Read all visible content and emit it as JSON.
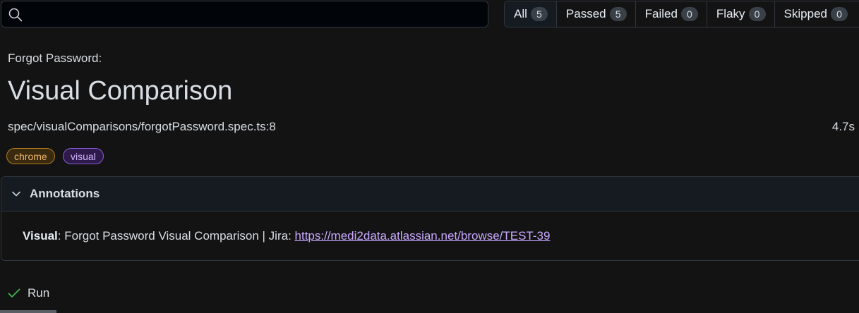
{
  "search": {
    "value": "",
    "placeholder": ""
  },
  "filters": [
    {
      "label": "All",
      "count": "5"
    },
    {
      "label": "Passed",
      "count": "5"
    },
    {
      "label": "Failed",
      "count": "0"
    },
    {
      "label": "Flaky",
      "count": "0"
    },
    {
      "label": "Skipped",
      "count": "0"
    }
  ],
  "test": {
    "project": "Forgot Password:",
    "title": "Visual Comparison",
    "location": "spec/visualComparisons/forgotPassword.spec.ts:8",
    "duration": "4.7s",
    "tags": [
      "chrome",
      "visual"
    ]
  },
  "annotations": {
    "header": "Annotations",
    "type": "Visual",
    "separator": ": ",
    "description": "Forgot Password Visual Comparison | Jira: ",
    "link": "https://medi2data.atlassian.net/browse/TEST-39"
  },
  "run": {
    "label": "Run"
  },
  "colors": {
    "background": "#131313",
    "chrome_tag": "#b67c1f",
    "visual_tag": "#8a5cd6",
    "link": "#c9a8ff",
    "pass_check": "#3fb950"
  },
  "icons": {
    "search": "search-icon",
    "chevron": "chevron-down-icon",
    "check": "check-icon"
  }
}
